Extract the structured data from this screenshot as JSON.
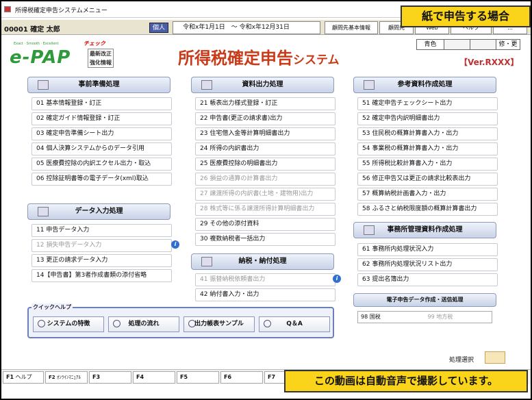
{
  "window": {
    "title": "所得税確定申告システムメニュー"
  },
  "callout_top": "紙で申告する場合",
  "callout_bottom": "この動画は自動音声で撮影しています。",
  "userbar": {
    "user": "00001 確定 太郎",
    "kojin": "個人",
    "period": "令和x年1月1日　～ 令和x年12月31日",
    "buttons": [
      "顧問先基本情報",
      "顧問先",
      "Web",
      "ヘルプ",
      "…"
    ]
  },
  "header": {
    "logo": "e-PAP",
    "logo_tag": "Exact · Smooth · Excellent",
    "check_label": "チェック",
    "check_box": [
      "最新改正",
      "強化情報"
    ],
    "app_title_main": "所得税確定申告",
    "app_title_sys": "システム",
    "color_label": "青色",
    "edit_label": "修・更",
    "version": "【Ver.RXXX】"
  },
  "columns": {
    "jizen": {
      "title": "事前準備処理",
      "items": [
        "01 基本情報登録・訂正",
        "02 確定ガイド情報登録・訂正",
        "03 確定申告準備シート出力",
        "04 個人決算システムからのデータ引用",
        "05 医療費控除の内訳エクセル出力・取込",
        "06 控除証明書等の電子データ(xml)取込"
      ]
    },
    "data": {
      "title": "データ入力処理",
      "items": [
        "11 申告データ入力",
        "12 損失申告データ入力",
        "13 更正の請求データ入力",
        "14【申告書】第3者作成書類の添付省略"
      ]
    },
    "shiryo": {
      "title": "資料出力処理",
      "items": [
        "21 帳表出力様式登録・訂正",
        "22 申告書(更正の請求書)出力",
        "23 住宅借入金等計算明細書出力",
        "24 所得の内訳書出力",
        "25 医療費控除の明細書出力",
        "26 損益の通算の計算書出力",
        "27 譲渡所得の内訳書(土地・建物用)出力",
        "28 株式等に係る譲渡所得計算明細書出力",
        "29 その他の添付資料",
        "30 複数納税者一括出力"
      ]
    },
    "nozei": {
      "title": "納税・納付処理",
      "items": [
        "41 振替納税依頼書出力",
        "42 納付書入力・出力"
      ]
    },
    "sanko": {
      "title": "参考資料作成処理",
      "items": [
        "51 確定申告チェックシート出力",
        "52 確定申告内訳明細書出力",
        "53 住民税の概算計算書入力・出力",
        "54 事業税の概算計算書入力・出力",
        "55 所得税比較計算書入力・出力",
        "56 修正申告又は更正の請求比較表出力",
        "57 概算納税計画書入力・出力",
        "58 ふるさと納税限度額の概算計算書出力"
      ]
    },
    "jimusho": {
      "title": "事務所管理資料作成処理",
      "items": [
        "61 事務所内処理状況入力",
        "62 事務所内処理状況リスト出力",
        "63 提出名簿出力"
      ]
    }
  },
  "denshi": {
    "title": "電子申告データ作成・送信処理",
    "kokuzei": "98 国税",
    "chiho": "99 地方税"
  },
  "quickhelp": {
    "label": "クイックヘルプ",
    "buttons": [
      "システムの特徴",
      "処理の流れ",
      "出力帳表サンプル",
      "Q＆A"
    ]
  },
  "shori_label": "処理選択",
  "fkeys": [
    {
      "key": "F1",
      "label": "ヘルプ"
    },
    {
      "key": "F2",
      "label": "ｵﾝﾗｲﾝﾏﾆｭｱﾙ"
    },
    {
      "key": "F3",
      "label": ""
    },
    {
      "key": "F4",
      "label": ""
    },
    {
      "key": "F5",
      "label": ""
    },
    {
      "key": "F6",
      "label": ""
    },
    {
      "key": "F7",
      "label": ""
    }
  ]
}
